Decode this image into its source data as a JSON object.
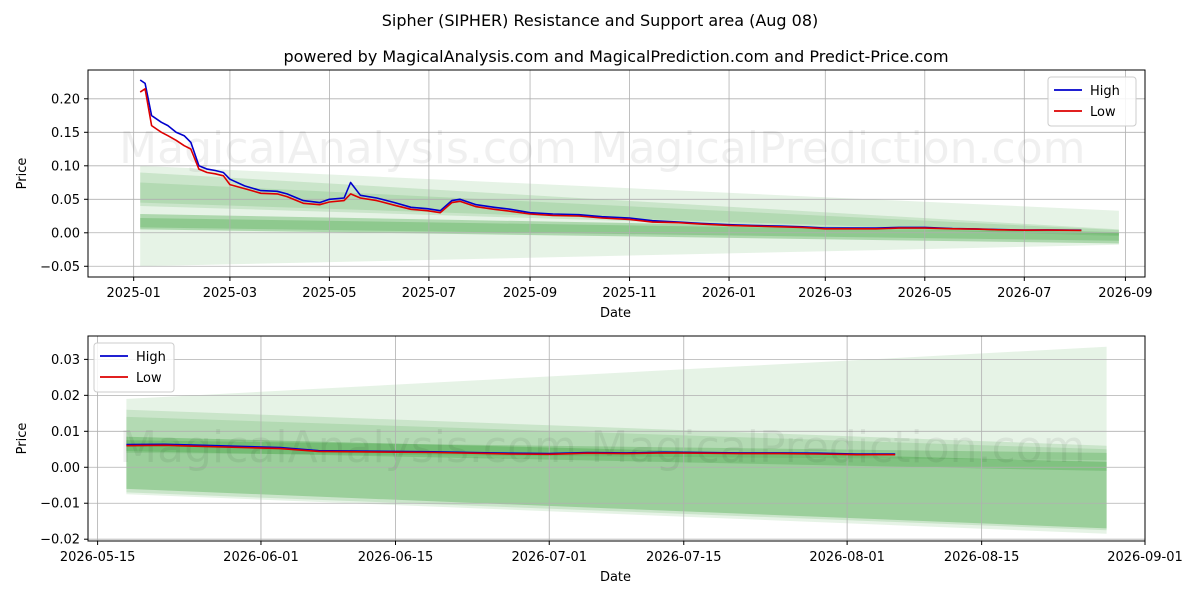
{
  "title": "Sipher (SIPHER) Resistance and Support area (Aug 08)",
  "subtitle": "powered by MagicalAnalysis.com and MagicalPrediction.com and Predict-Price.com",
  "watermarks": [
    "MagicalAnalysis.com",
    "MagicalPrediction.com"
  ],
  "colors": {
    "high": "#0000cc",
    "low": "#dd0000",
    "band": "#2e9a2e"
  },
  "chart_data": [
    {
      "type": "line",
      "xlabel": "Date",
      "ylabel": "Price",
      "x_ticks": [
        "2025-01",
        "2025-03",
        "2025-05",
        "2025-07",
        "2025-09",
        "2025-11",
        "2026-01",
        "2026-03",
        "2026-05",
        "2026-07",
        "2026-09"
      ],
      "y_ticks": [
        "0.20",
        "0.15",
        "0.10",
        "0.05",
        "0.00",
        "−0.05"
      ],
      "ylim": [
        -0.066,
        0.243
      ],
      "xlim": [
        "2024-12-04",
        "2026-09-13"
      ],
      "legend": {
        "position": "top-right",
        "entries": [
          "High",
          "Low"
        ]
      },
      "grid": true,
      "series": [
        {
          "name": "High",
          "x": [
            "2025-01-05",
            "2025-01-08",
            "2025-01-12",
            "2025-01-15",
            "2025-01-18",
            "2025-01-22",
            "2025-01-27",
            "2025-02-01",
            "2025-02-05",
            "2025-02-10",
            "2025-02-15",
            "2025-02-20",
            "2025-02-25",
            "2025-03-01",
            "2025-03-10",
            "2025-03-20",
            "2025-03-30",
            "2025-04-05",
            "2025-04-15",
            "2025-04-25",
            "2025-05-01",
            "2025-05-10",
            "2025-05-14",
            "2025-05-20",
            "2025-05-30",
            "2025-06-10",
            "2025-06-20",
            "2025-06-30",
            "2025-07-08",
            "2025-07-15",
            "2025-07-20",
            "2025-07-30",
            "2025-08-10",
            "2025-08-20",
            "2025-09-01",
            "2025-09-15",
            "2025-10-01",
            "2025-10-15",
            "2025-11-01",
            "2025-11-15",
            "2025-12-01",
            "2025-12-15",
            "2026-01-01",
            "2026-01-15",
            "2026-02-01",
            "2026-02-15",
            "2026-03-01",
            "2026-03-15",
            "2026-04-01",
            "2026-04-15",
            "2026-05-01",
            "2026-05-18",
            "2026-06-01",
            "2026-06-15",
            "2026-07-01",
            "2026-07-15",
            "2026-08-05"
          ],
          "y": [
            0.228,
            0.223,
            0.175,
            0.17,
            0.165,
            0.16,
            0.15,
            0.145,
            0.135,
            0.1,
            0.095,
            0.093,
            0.09,
            0.08,
            0.07,
            0.063,
            0.062,
            0.058,
            0.048,
            0.045,
            0.05,
            0.052,
            0.075,
            0.056,
            0.052,
            0.045,
            0.038,
            0.036,
            0.033,
            0.048,
            0.05,
            0.042,
            0.038,
            0.035,
            0.03,
            0.028,
            0.027,
            0.024,
            0.022,
            0.018,
            0.016,
            0.014,
            0.012,
            0.011,
            0.01,
            0.009,
            0.007,
            0.007,
            0.007,
            0.008,
            0.008,
            0.0062,
            0.0058,
            0.0048,
            0.004,
            0.0043,
            0.0038
          ]
        },
        {
          "name": "Low",
          "x": [
            "2025-01-05",
            "2025-01-08",
            "2025-01-12",
            "2025-01-15",
            "2025-01-18",
            "2025-01-22",
            "2025-01-27",
            "2025-02-01",
            "2025-02-05",
            "2025-02-10",
            "2025-02-15",
            "2025-02-20",
            "2025-02-25",
            "2025-03-01",
            "2025-03-10",
            "2025-03-20",
            "2025-03-30",
            "2025-04-05",
            "2025-04-15",
            "2025-04-25",
            "2025-05-01",
            "2025-05-10",
            "2025-05-14",
            "2025-05-20",
            "2025-05-30",
            "2025-06-10",
            "2025-06-20",
            "2025-06-30",
            "2025-07-08",
            "2025-07-15",
            "2025-07-20",
            "2025-07-30",
            "2025-08-10",
            "2025-08-20",
            "2025-09-01",
            "2025-09-15",
            "2025-10-01",
            "2025-10-15",
            "2025-11-01",
            "2025-11-15",
            "2025-12-01",
            "2025-12-15",
            "2026-01-01",
            "2026-01-15",
            "2026-02-01",
            "2026-02-15",
            "2026-03-01",
            "2026-03-15",
            "2026-04-01",
            "2026-04-15",
            "2026-05-01",
            "2026-05-18",
            "2026-06-01",
            "2026-06-15",
            "2026-07-01",
            "2026-07-15",
            "2026-08-05"
          ],
          "y": [
            0.21,
            0.215,
            0.16,
            0.155,
            0.15,
            0.145,
            0.138,
            0.13,
            0.125,
            0.095,
            0.09,
            0.088,
            0.085,
            0.072,
            0.066,
            0.059,
            0.058,
            0.054,
            0.044,
            0.042,
            0.046,
            0.048,
            0.058,
            0.052,
            0.048,
            0.041,
            0.035,
            0.033,
            0.03,
            0.045,
            0.047,
            0.039,
            0.035,
            0.032,
            0.028,
            0.026,
            0.025,
            0.022,
            0.02,
            0.016,
            0.015,
            0.013,
            0.011,
            0.01,
            0.009,
            0.008,
            0.006,
            0.006,
            0.006,
            0.007,
            0.007,
            0.006,
            0.0055,
            0.0045,
            0.0038,
            0.004,
            0.0036
          ]
        }
      ],
      "bands": [
        {
          "x": [
            "2025-01-05",
            "2026-08-28"
          ],
          "lower": [
            -0.05,
            -0.018
          ],
          "upper": [
            0.1,
            0.033
          ],
          "alpha": 0.12
        },
        {
          "x": [
            "2025-01-05",
            "2026-08-28"
          ],
          "lower": [
            0.04,
            -0.005
          ],
          "upper": [
            0.09,
            0.005
          ],
          "alpha": 0.15
        },
        {
          "x": [
            "2025-01-05",
            "2026-08-28"
          ],
          "lower": [
            0.045,
            -0.003
          ],
          "upper": [
            0.075,
            0.004
          ],
          "alpha": 0.15
        },
        {
          "x": [
            "2025-01-05",
            "2026-08-28"
          ],
          "lower": [
            0.005,
            -0.016
          ],
          "upper": [
            0.028,
            0.001
          ],
          "alpha": 0.3
        },
        {
          "x": [
            "2025-01-05",
            "2026-08-28"
          ],
          "lower": [
            0.008,
            -0.012
          ],
          "upper": [
            0.022,
            0.0
          ],
          "alpha": 0.25
        }
      ]
    },
    {
      "type": "line",
      "xlabel": "Date",
      "ylabel": "Price",
      "x_ticks": [
        "2026-05-15",
        "2026-06-01",
        "2026-06-15",
        "2026-07-01",
        "2026-07-15",
        "2026-08-01",
        "2026-08-15",
        "2026-09-01"
      ],
      "y_ticks": [
        "0.03",
        "0.02",
        "0.01",
        "0.00",
        "−0.01",
        "−0.02"
      ],
      "ylim": [
        -0.0205,
        0.0365
      ],
      "xlim": [
        "2026-05-14",
        "2026-09-01"
      ],
      "legend": {
        "position": "top-left",
        "entries": [
          "High",
          "Low"
        ]
      },
      "grid": true,
      "series": [
        {
          "name": "High",
          "x": [
            "2026-05-18",
            "2026-05-22",
            "2026-05-26",
            "2026-05-30",
            "2026-06-03",
            "2026-06-07",
            "2026-06-11",
            "2026-06-15",
            "2026-06-19",
            "2026-06-23",
            "2026-06-27",
            "2026-07-01",
            "2026-07-05",
            "2026-07-09",
            "2026-07-13",
            "2026-07-17",
            "2026-07-21",
            "2026-07-25",
            "2026-07-29",
            "2026-08-02",
            "2026-08-06"
          ],
          "y": [
            0.0063,
            0.0064,
            0.0061,
            0.0058,
            0.0055,
            0.0046,
            0.0045,
            0.0044,
            0.0043,
            0.0041,
            0.0039,
            0.0038,
            0.0041,
            0.004,
            0.0042,
            0.0041,
            0.004,
            0.004,
            0.0039,
            0.0037,
            0.0037
          ]
        },
        {
          "name": "Low",
          "x": [
            "2026-05-18",
            "2026-05-22",
            "2026-05-26",
            "2026-05-30",
            "2026-06-03",
            "2026-06-07",
            "2026-06-11",
            "2026-06-15",
            "2026-06-19",
            "2026-06-23",
            "2026-06-27",
            "2026-07-01",
            "2026-07-05",
            "2026-07-09",
            "2026-07-13",
            "2026-07-17",
            "2026-07-21",
            "2026-07-25",
            "2026-07-29",
            "2026-08-02",
            "2026-08-06"
          ],
          "y": [
            0.006,
            0.0061,
            0.0058,
            0.0055,
            0.0052,
            0.0044,
            0.0043,
            0.0042,
            0.0041,
            0.0039,
            0.0037,
            0.0036,
            0.0039,
            0.0038,
            0.004,
            0.0039,
            0.0038,
            0.0038,
            0.0037,
            0.0035,
            0.0035
          ]
        }
      ],
      "bands": [
        {
          "x": [
            "2026-05-18",
            "2026-08-28"
          ],
          "lower": [
            -0.0075,
            -0.0185
          ],
          "upper": [
            0.019,
            0.0335
          ],
          "alpha": 0.12
        },
        {
          "x": [
            "2026-05-18",
            "2026-08-28"
          ],
          "lower": [
            -0.007,
            -0.0175
          ],
          "upper": [
            0.016,
            0.006
          ],
          "alpha": 0.15
        },
        {
          "x": [
            "2026-05-18",
            "2026-08-28"
          ],
          "lower": [
            0.004,
            0.002
          ],
          "upper": [
            0.014,
            0.005
          ],
          "alpha": 0.15
        },
        {
          "x": [
            "2026-05-18",
            "2026-08-28"
          ],
          "lower": [
            -0.006,
            -0.017
          ],
          "upper": [
            0.0085,
            0.0015
          ],
          "alpha": 0.3
        },
        {
          "x": [
            "2026-05-18",
            "2026-08-28"
          ],
          "lower": [
            0.0045,
            -0.001
          ],
          "upper": [
            0.0075,
            0.004
          ],
          "alpha": 0.25
        }
      ]
    }
  ]
}
